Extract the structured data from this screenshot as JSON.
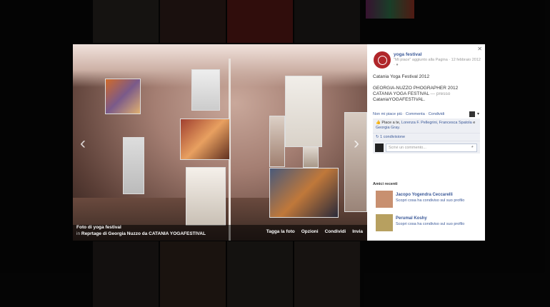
{
  "viewer": {
    "close_icon": "close-icon",
    "prev_icon": "chevron-left-icon",
    "next_icon": "chevron-right-icon",
    "caption": {
      "title": "Foto di yoga festival",
      "in_label": "in",
      "album": "Reprtage di Georgia Nuzzo da CATANIA YOGAFESTIVAL"
    },
    "actions": [
      "Tagga la foto",
      "Opzioni",
      "Condividi",
      "Invia"
    ]
  },
  "panel": {
    "page_name": "yoga festival",
    "liked_note": "\"Mi piace\" aggiunto alla Pagina · 12 febbraio 2012 · ",
    "post_line1": "Catania Yoga Festival 2012",
    "post_line2": "GEORGIA-NUZZO PHOGRAPHER 2012",
    "post_line3": "CATANIA YOGA FESTIVAL",
    "post_presso": " — presso",
    "post_line4": "CataniaYOGAFESTIVAL.",
    "action_like": "Non mi piace più",
    "action_comment": "Commenta",
    "action_share": "Condividi",
    "likes_prefix": "Piace a te, ",
    "likes_names": "Lorenza F. Pellegrini, Francesca Spatola",
    "likes_and": " e ",
    "likes_last": "Georgia Gray.",
    "shares": "1 condivisione",
    "comment_placeholder": "Scrivi un commento...",
    "friends_title": "Amici recenti",
    "friends": [
      {
        "name": "Jacopo Yogendra Ceccarelli",
        "link": "Scopri cosa ha condiviso sul suo profilo"
      },
      {
        "name": "Perumal Koshy",
        "link": "Scopri cosa ha condiviso sul suo profilo"
      }
    ]
  },
  "colors": {
    "link": "#3b5998",
    "brand": "#b0262a"
  }
}
